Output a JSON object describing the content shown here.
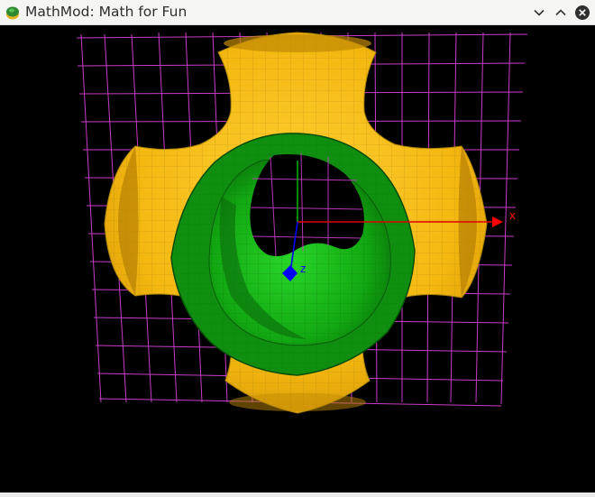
{
  "window": {
    "title": "MathMod: Math for Fun",
    "icon": "mathmod-app-icon",
    "controls": {
      "minimize_icon": "chevron-down-icon",
      "maximize_icon": "chevron-up-icon",
      "close_icon": "close-circle-icon"
    }
  },
  "viewport": {
    "background": "#000000",
    "grid_color": "#c83cc8",
    "surface_outer_color": "#f2b70f",
    "surface_inner_color": "#14a014",
    "axes": {
      "x_label": "x",
      "z_label": "z",
      "x_color": "#ff0000",
      "y_color": "#00c000",
      "z_color": "#0000ff"
    }
  }
}
